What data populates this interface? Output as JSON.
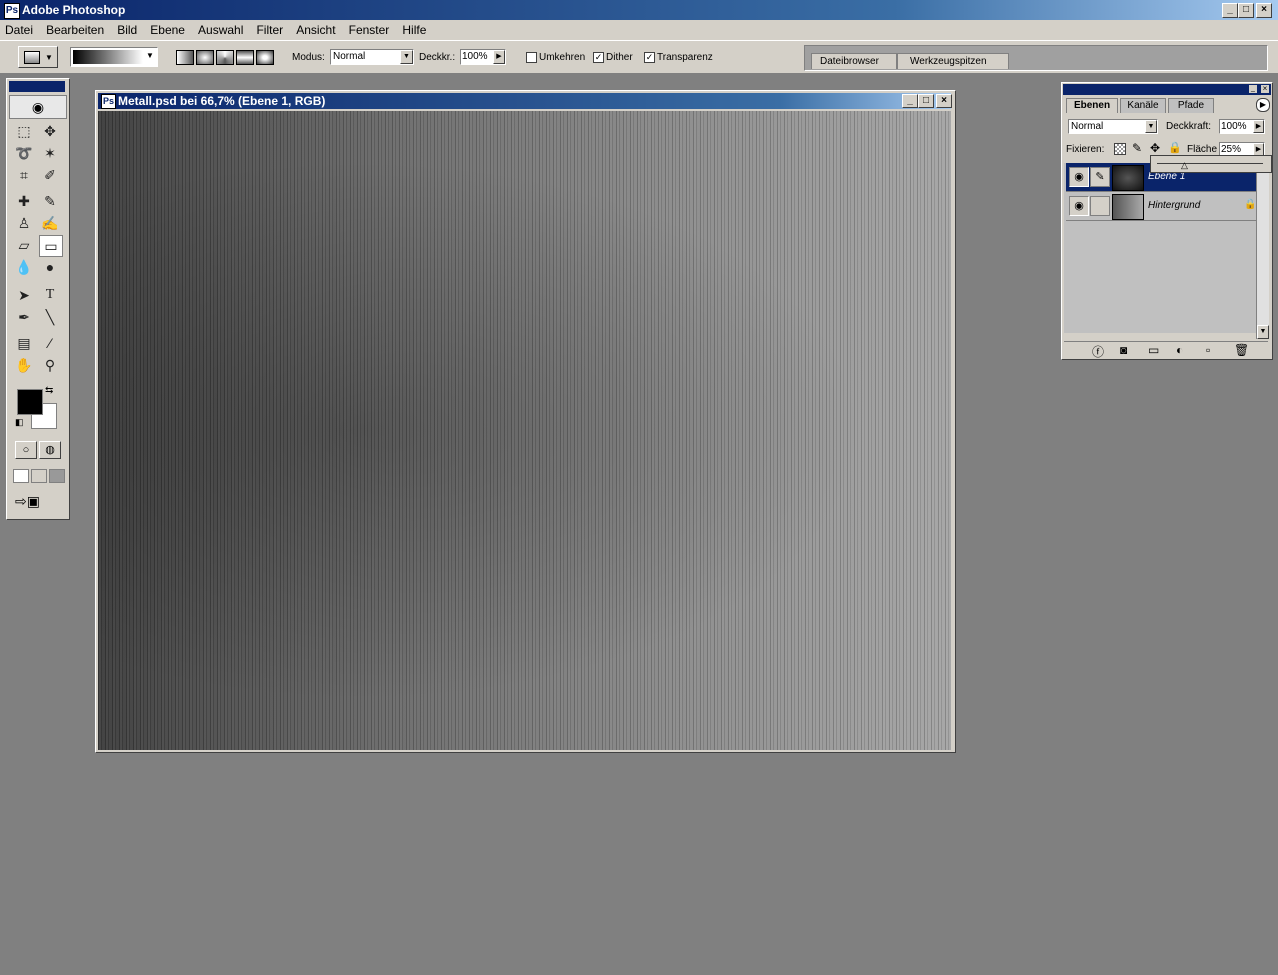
{
  "app": {
    "title": "Adobe Photoshop"
  },
  "menu": [
    "Datei",
    "Bearbeiten",
    "Bild",
    "Ebene",
    "Auswahl",
    "Filter",
    "Ansicht",
    "Fenster",
    "Hilfe"
  ],
  "options": {
    "modus_label": "Modus:",
    "modus_value": "Normal",
    "deckkr_label": "Deckkr.:",
    "deckkr_value": "100%",
    "umkehren_label": "Umkehren",
    "dither_label": "Dither",
    "transparenz_label": "Transparenz",
    "umkehren_checked": false,
    "dither_checked": true,
    "transparenz_checked": true
  },
  "palette_well": {
    "tabs": [
      "Dateibrowser",
      "Werkzeugspitzen"
    ]
  },
  "document": {
    "title": "Metall.psd bei 66,7% (Ebene 1, RGB)"
  },
  "layers_panel": {
    "tabs": [
      "Ebenen",
      "Kanäle",
      "Pfade"
    ],
    "active_tab": "Ebenen",
    "blend_mode": "Normal",
    "opacity_label": "Deckkraft:",
    "opacity_value": "100%",
    "lock_label": "Fixieren:",
    "fill_label": "Fläche",
    "fill_value": "25%",
    "layers": [
      {
        "name": "Ebene 1",
        "selected": true,
        "visible": true
      },
      {
        "name": "Hintergrund",
        "selected": false,
        "visible": true,
        "locked": true
      }
    ]
  },
  "colors": {
    "accent": "#0a246a",
    "chrome": "#d4d0c8",
    "workspace": "#808080"
  }
}
